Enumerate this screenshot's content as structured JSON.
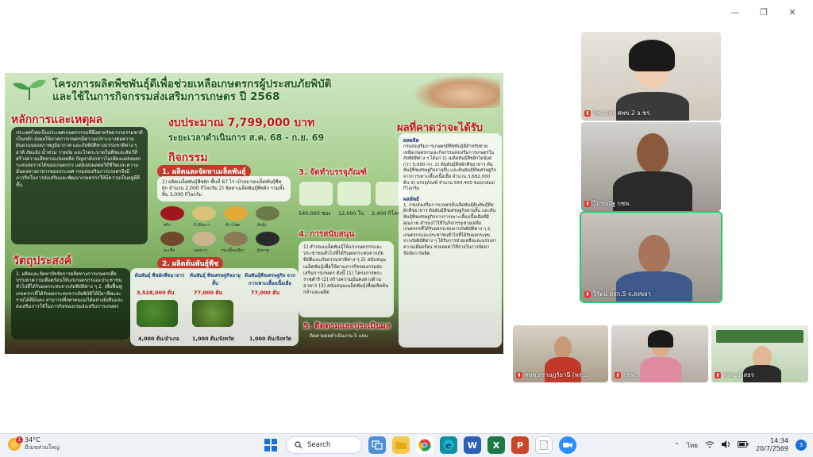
{
  "window": {
    "minimize": "—",
    "restore": "❐",
    "close": "✕"
  },
  "poster": {
    "title_line1": "โครงการผลิตพืชพันธุ์ดีเพื่อช่วยเหลือเกษตรกรผู้ประสบภัยพิบัติ",
    "title_line2": "และใช้ในการกิจกรรมส่งเสริมการเกษตร ปี 2568",
    "principles_head": "หลักการและเหตุผล",
    "principles_text": "ประเทศไทยเป็นประเทศเกษตรกรรมที่พึ่งพาทรัพยากรธรรมชาติเป็นหลัก ส่งผลให้ภาคการเกษตรมีความเปราะบางต่อความผันผวนของสภาพภูมิอากาศ และภัยพิบัติทางธรรมชาติต่าง ๆ อาทิ ภัยแล้ง น้ำท่วม วาตภัย และโรคระบาดในพืชและสัตว์ที่สร้างความเสียหายแก่ผลผลิต ปัญหาดังกล่าวไม่เพียงแต่ส่งผลกระทบต่อรายได้ของเกษตรกร แต่ยังส่งผลต่อวิถีชีวิตและความมั่นคงทางอาหารของประเทศ กรมส่งเสริมการเกษตรจึงมีภารกิจในการส่งเสริมและพัฒนาเกษตรกรให้มีความเป็นอยู่ที่ดีขึ้น",
    "budget": "งบประมาณ 7,799,000 บาท",
    "period": "ระยะเวลาดำเนินการ ส.ค. 68 - ก.ย. 69",
    "activities_head": "กิจกรรม",
    "act1_head": "1. ผลิตและจัดหาเมล็ดพันธุ์",
    "act1_text": "1) ผลิตเมล็ดพันธุ์พืชผัก พื้นที่ 67 ไร่ เป้าหมายเมล็ดพันธุ์พืชผัก จำนวน 2,000 กิโลกรัม 2) จัดหาเมล็ดพันธุ์พืชผัก รวมทั้งสิ้น 3,000 กิโลกรัม",
    "seeds": [
      "พริก",
      "ถั่วฝักยาว",
      "ข้าวโพด",
      "ผักบุ้ง",
      "มะเขือ",
      "แตงกวา",
      "กระเจี๊ยบเขียว",
      "ผักกาด"
    ],
    "act2_head": "2. ผลิตต้นพันธุ์พืช",
    "plants": [
      {
        "head": "ต้นพันธุ์ พืชผักพืชอาหาร",
        "value": "3,528,000 ต้น",
        "rate": "4,000 ต้น/อำเภอ"
      },
      {
        "head": "ต้นพันธุ์ พืชเศรษฐกิจอายุสั้น",
        "value": "77,000 ต้น",
        "rate": "1,000 ต้น/จังหวัด"
      },
      {
        "head": "ต้นพันธุ์พืชเศรษฐกิจ จากการเพาะเลี้ยงเนื้อเยื่อ",
        "value": "77,000 ต้น",
        "rate": "1,000 ต้น/จังหวัด"
      }
    ],
    "act3_head": "3. จัดทำบรรจุภัณฑ์",
    "act3_values": [
      "540,000 ซอง",
      "12,000 ใบ",
      "2,400 กิโลกรัม"
    ],
    "act4_head": "4. การสนับสนุน",
    "act4_text": "1) สำรองเมล็ดพันธุ์ให้แก่เกษตรกรและประชาชนทั่วไปที่ได้รับผลกระทบจากภัยพิบัติและภัยธรรมชาติต่าง ๆ 2) สนับสนุนเมล็ดพันธุ์เพื่อใช้ตามภารกิจของกรมส่งเสริมการเกษตร ดังนี้ (1) โครงการพระราชดำริ (2) สร้างความมั่นคงทางด้านอาหาร (3) สนับสนุนเมล็ดพันธุ์เพื่อผลิตต้นกล้าและผลิต",
    "act5_head": "5. ติดตามและประเมินผล",
    "act5_text": "ติดตามผลดำเนินงาน 5 แผน",
    "objectives_head": "วัตถุประสงค์",
    "objectives_text": "1. ผลิตและจัดหาปัจจัยการผลิตทางการเกษตรเพื่อบรรเทาความเดือดร้อนให้แก่เกษตรกรและประชาชนทั่วไปที่ได้รับผลกระทบจากภัยพิบัติต่าง ๆ 2. เพื่อฟื้นฟูเกษตรกรที่ได้รับผลกระทบจากภัยพิบัติให้มีอาชีพและรายได้ที่มั่นคง สามารถพึ่งพาตนเองได้อย่างยั่งยืนและส่งเสริมการใช้ในภารกิจของกรมส่งเสริมการเกษตร",
    "results_head": "ผลที่คาดว่าจะได้รับ",
    "output_head": "ผลผลิต",
    "output_text": "กรมส่งเสริมการเกษตรมีพืชพันธุ์ดีสำหรับช่วยเหลือเกษตรกรและกิจกรรมส่งเสริมการเกษตรในภัยพิบัติต่าง ๆ ได้แก่ 1) เมล็ดพันธุ์พืชผักไม่น้อยกว่า 5,000 กก. 2) ต้นพันธุ์พืชผักพืชอาหาร ต้นพันธุ์พืชเศรษฐกิจอายุสั้น และต้นพันธุ์พืชเศรษฐกิจจากการเพาะเลี้ยงเนื้อเยื่อ จำนวน 3,682,000 ต้น 3) บรรจุภัณฑ์ จำนวน 554,400 ซอง/กล่อง/กิโลกรัม",
    "outcome_head": "ผลลัพธ์",
    "outcome_text": "1. กรมส่งเสริมการเกษตรมีเมล็ดพันธุ์ต้นพันธุ์พืชผักพืชอาหาร ต้นพันธุ์พืชเศรษฐกิจอายุสั้น และต้นพันธุ์พืชเศรษฐกิจจากการเพาะเลี้ยงเนื้อเยื่อที่มีคุณภาพ สำรองไว้ใช้ในกิจกรรมช่วยเหลือเกษตรกรที่ได้รับผลกระทบจากภัยพิบัติต่าง ๆ 2. เกษตรกรและประชาชนทั่วไปที่ได้รับผลกระทบจากภัยพิบัติต่าง ๆ ได้รับการช่วยเหลือและบรรเทาความเดือดร้อน ช่วยลดค่าใช้จ่ายในการจัดหาปัจจัยการผลิต"
  },
  "participants": [
    {
      "name": "นิชาภัทร์ ศพข.2 จ.ชร.",
      "muted": true
    },
    {
      "name": "ไปรยณัฐ กชพ.",
      "muted": true
    },
    {
      "name": "วิรัตน์ สสก.5 จ.สงขลา",
      "muted": true
    },
    {
      "name": "ศสพ.สุราษฎร์ธานี (พร...",
      "muted": true
    },
    {
      "name": "กชพ.",
      "muted": true
    },
    {
      "name": "ศสพ.ปโสธร",
      "muted": true
    }
  ],
  "taskbar": {
    "temperature": "34°C",
    "weather_text": "มีเมฆส่วนใหญ่",
    "weather_badge": "1",
    "search_label": "Search",
    "lang": "ไทย",
    "time": "14:34",
    "date": "20/7/2569",
    "notif_count": "3",
    "apps": [
      {
        "name": "word",
        "glyph": "W",
        "color": "#2b5fb8"
      },
      {
        "name": "excel",
        "glyph": "X",
        "color": "#1d7a45"
      },
      {
        "name": "powerpoint",
        "glyph": "P",
        "color": "#c9482a"
      },
      {
        "name": "zoom",
        "glyph": "Z",
        "color": "#2d8cff"
      }
    ]
  }
}
